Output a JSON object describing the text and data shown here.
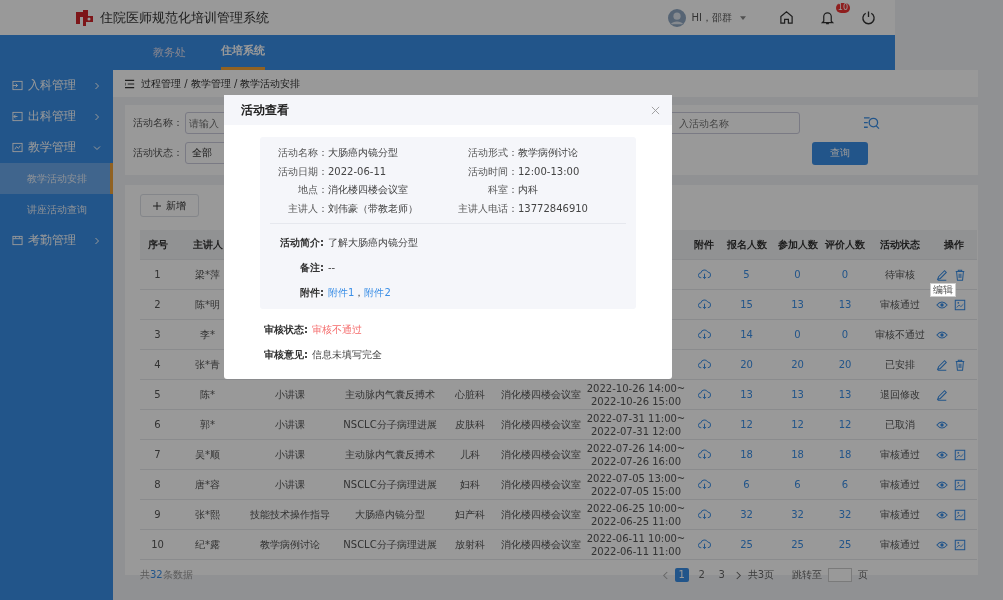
{
  "header": {
    "title": "住院医师规范化培训管理系统",
    "user": "HI，邵群",
    "notification_count": "10"
  },
  "nav_tabs": [
    {
      "label": "教务处",
      "selected": false
    },
    {
      "label": "住培系统",
      "selected": true
    }
  ],
  "sidebar": {
    "items": [
      {
        "label": "入科管理",
        "expanded": false
      },
      {
        "label": "出科管理",
        "expanded": false
      },
      {
        "label": "教学管理",
        "expanded": true,
        "children": [
          {
            "label": "教学活动安排",
            "selected": true
          },
          {
            "label": "讲座活动查询",
            "selected": false
          }
        ]
      },
      {
        "label": "考勤管理",
        "expanded": false
      }
    ]
  },
  "breadcrumb": "过程管理 / 教学管理 / 教学活动安排",
  "filters": {
    "name_label": "活动名称：",
    "name_placeholder": "请输入",
    "second_placeholder": "入活动名称",
    "status_label": "活动状态：",
    "status_value": "全部",
    "query_button": "查询"
  },
  "add_button": "新增",
  "table": {
    "columns_left": [
      "序号",
      "主讲人"
    ],
    "columns_right": [
      "附件",
      "报名人数",
      "参加人数",
      "评价人数",
      "活动状态",
      "操作"
    ],
    "rows": [
      {
        "no": "1",
        "speaker": "梁*萍",
        "signup": "5",
        "attend": "0",
        "rated": "0",
        "status": "待审核",
        "actions": [
          {
            "kind": "edit",
            "tooltip": "编辑"
          },
          {
            "kind": "delete"
          }
        ]
      },
      {
        "no": "2",
        "speaker": "陈*明",
        "signup": "15",
        "attend": "13",
        "rated": "13",
        "status": "审核通过",
        "actions": [
          {
            "kind": "view"
          },
          {
            "kind": "image"
          }
        ]
      },
      {
        "no": "3",
        "speaker": "李*",
        "signup": "14",
        "attend": "0",
        "rated": "0",
        "status": "审核不通过",
        "actions": [
          {
            "kind": "view"
          }
        ]
      },
      {
        "no": "4",
        "speaker": "张*青",
        "signup": "20",
        "attend": "20",
        "rated": "20",
        "status": "已安排",
        "actions": [
          {
            "kind": "edit"
          },
          {
            "kind": "delete"
          }
        ]
      },
      {
        "no": "5",
        "speaker": "陈*",
        "type": "小讲课",
        "topic": "主动脉内气囊反搏术",
        "dept": "心脏科",
        "place": "消化楼四楼会议室",
        "time": [
          "2022-10-26 14:00~",
          "2022-10-26 15:00"
        ],
        "signup": "13",
        "attend": "13",
        "rated": "13",
        "status": "退回修改",
        "actions": [
          {
            "kind": "edit"
          }
        ]
      },
      {
        "no": "6",
        "speaker": "郭*",
        "type": "小讲课",
        "topic": "NSCLC分子病理进展",
        "dept": "皮肤科",
        "place": "消化楼四楼会议室",
        "time": [
          "2022-07-31 11:00~",
          "2022-07-31 12:00"
        ],
        "signup": "12",
        "attend": "12",
        "rated": "12",
        "status": "已取消",
        "actions": [
          {
            "kind": "view"
          }
        ]
      },
      {
        "no": "7",
        "speaker": "吴*顺",
        "type": "小讲课",
        "topic": "主动脉内气囊反搏术",
        "dept": "儿科",
        "place": "消化楼四楼会议室",
        "time": [
          "2022-07-26 14:00~",
          "2022-07-26 16:00"
        ],
        "signup": "18",
        "attend": "18",
        "rated": "18",
        "status": "审核通过",
        "actions": [
          {
            "kind": "view"
          },
          {
            "kind": "image"
          }
        ]
      },
      {
        "no": "8",
        "speaker": "唐*容",
        "type": "小讲课",
        "topic": "NSCLC分子病理进展",
        "dept": "妇科",
        "place": "消化楼四楼会议室",
        "time": [
          "2022-07-05 13:00~",
          "2022-07-05 15:00"
        ],
        "signup": "6",
        "attend": "6",
        "rated": "6",
        "status": "审核通过",
        "actions": [
          {
            "kind": "view"
          },
          {
            "kind": "image"
          }
        ]
      },
      {
        "no": "9",
        "speaker": "张*熙",
        "type": "技能技术操作指导",
        "topic": "大肠癌内镜分型",
        "dept": "妇产科",
        "place": "消化楼四楼会议室",
        "time": [
          "2022-06-25 10:00~",
          "2022-06-25 11:00"
        ],
        "signup": "32",
        "attend": "32",
        "rated": "32",
        "status": "审核通过",
        "actions": [
          {
            "kind": "view"
          },
          {
            "kind": "image"
          }
        ]
      },
      {
        "no": "10",
        "speaker": "纪*露",
        "type": "教学病例讨论",
        "topic": "NSCLC分子病理进展",
        "dept": "放射科",
        "place": "消化楼四楼会议室",
        "time": [
          "2022-06-11 10:00~",
          "2022-06-11 11:00"
        ],
        "signup": "25",
        "attend": "25",
        "rated": "25",
        "status": "审核通过",
        "actions": [
          {
            "kind": "view"
          },
          {
            "kind": "image"
          }
        ]
      }
    ]
  },
  "pagination": {
    "total_prefix": "共",
    "total_count": "32",
    "total_suffix": "条数据",
    "pages": [
      {
        "label": "1",
        "selected": true
      },
      {
        "label": "2",
        "selected": false
      },
      {
        "label": "3",
        "selected": false
      }
    ],
    "page_count": "共3页",
    "jump_label": "跳转至",
    "page_unit": "页"
  },
  "modal": {
    "title": "活动查看",
    "fields": [
      {
        "label": "活动名称：",
        "value": "大肠癌内镜分型"
      },
      {
        "label": "活动形式：",
        "value": "教学病例讨论"
      },
      {
        "label": "活动日期：",
        "value": "2022-06-11"
      },
      {
        "label": "活动时间：",
        "value": "12:00-13:00"
      },
      {
        "label": "地点：",
        "value": "消化楼四楼会议室"
      },
      {
        "label": "科室：",
        "value": "内科"
      },
      {
        "label": "主讲人：",
        "value": "刘伟豪（带教老师）"
      },
      {
        "label": "主讲人电话：",
        "value": "13772846910"
      }
    ],
    "intro_label": "活动简介:",
    "intro": "了解大肠癌内镜分型",
    "remark_label": "备注:",
    "remark": "--",
    "attachments_label": "附件:",
    "attachments": [
      "附件1",
      "附件2"
    ],
    "attachment_separator": "，",
    "review_status_label": "审核状态:",
    "review_status": "审核不通过",
    "review_comment_label": "审核意见:",
    "review_comment": "信息未填写完全"
  }
}
